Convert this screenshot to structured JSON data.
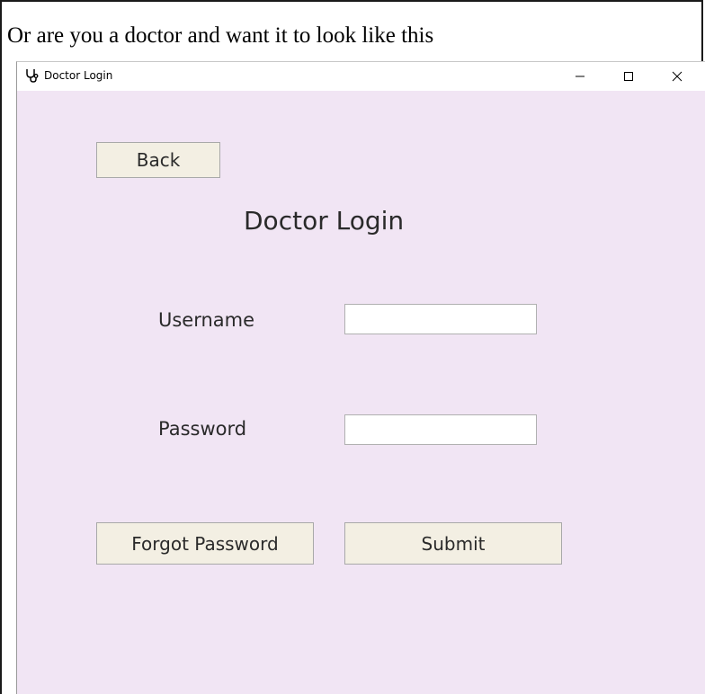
{
  "caption": "Or are you a doctor and want it to look like this",
  "window": {
    "title": "Doctor Login",
    "icon": "stethoscope-icon",
    "controls": [
      "minimize-icon",
      "maximize-icon",
      "close-icon"
    ],
    "background": "#f1e5f4"
  },
  "form": {
    "back_label": "Back",
    "heading": "Doctor Login",
    "username_label": "Username",
    "username_value": "",
    "password_label": "Password",
    "password_value": "",
    "forgot_label": "Forgot Password",
    "submit_label": "Submit"
  },
  "colors": {
    "button_bg": "#f3efe3",
    "client_bg": "#f1e5f4"
  }
}
